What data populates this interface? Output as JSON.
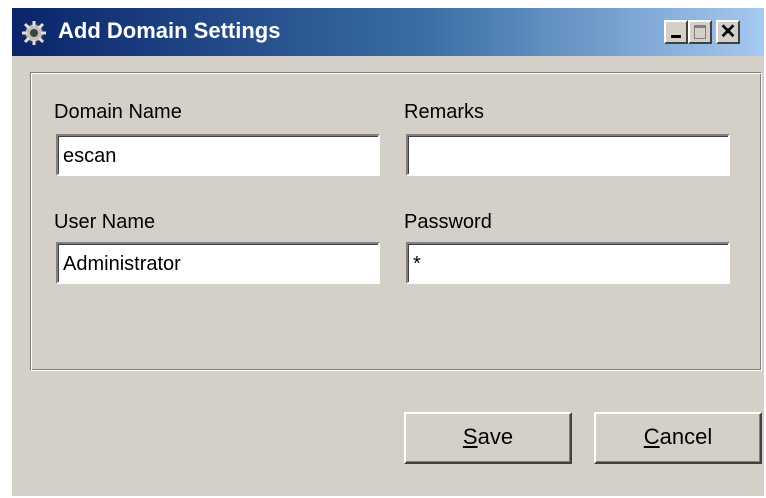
{
  "window": {
    "title": "Add Domain Settings"
  },
  "form": {
    "domain_name_label": "Domain Name",
    "domain_name_value": "escan",
    "remarks_label": "Remarks",
    "remarks_value": "",
    "user_name_label": "User Name",
    "user_name_value": "Administrator",
    "password_label": "Password",
    "password_value": "*"
  },
  "buttons": {
    "save_label": "Save",
    "save_mnemonic": "S",
    "cancel_label": "Cancel",
    "cancel_mnemonic": "C"
  },
  "title_buttons": {
    "close_glyph": "✕"
  }
}
